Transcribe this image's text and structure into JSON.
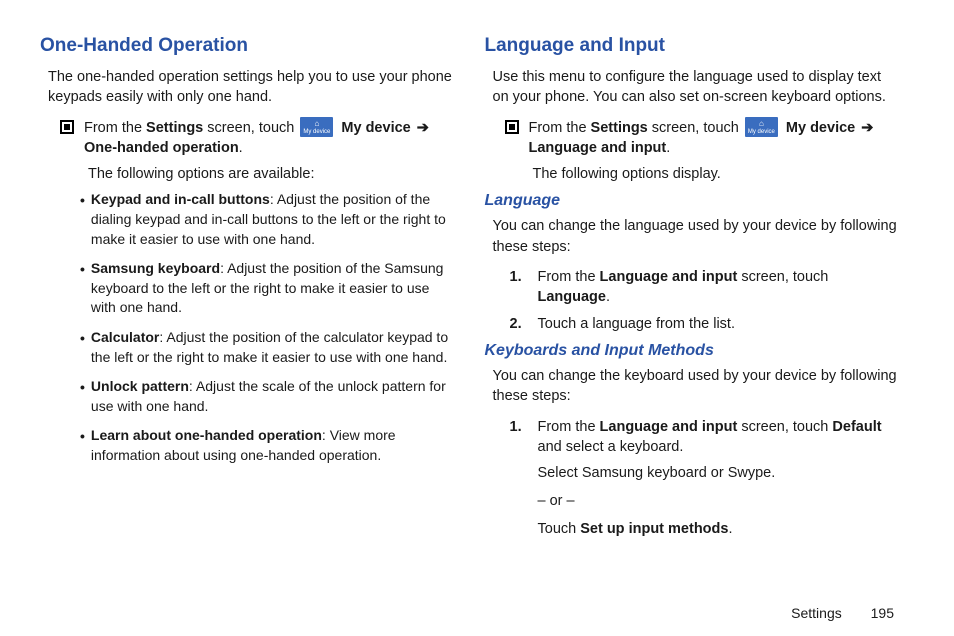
{
  "left": {
    "heading": "One-Handed Operation",
    "intro": "The one-handed operation settings help you to use your phone keypads easily with only one hand.",
    "step_prefix": "From the ",
    "settings_bold": "Settings",
    "step_mid": " screen, touch ",
    "icon_label": "My device",
    "my_device_bold": "My device",
    "arrow": "➔",
    "one_handed_bold": "One-handed operation",
    "period": ".",
    "following": "The following options are available:",
    "bullets": [
      {
        "bold": "Keypad and in-call buttons",
        "rest": ": Adjust the position of the dialing keypad and in-call buttons to the left or the right to make it easier to use with one hand."
      },
      {
        "bold": "Samsung keyboard",
        "rest": ": Adjust the position of the Samsung keyboard to the left or the right to make it easier to use with one hand."
      },
      {
        "bold": "Calculator",
        "rest": ": Adjust the position of the calculator keypad to the left or the right to make it easier to use with one hand."
      },
      {
        "bold": "Unlock pattern",
        "rest": ": Adjust the scale of the unlock pattern for use with one hand."
      },
      {
        "bold": "Learn about one-handed operation",
        "rest": ": View more information about using one-handed operation."
      }
    ]
  },
  "right": {
    "heading": "Language and Input",
    "intro": "Use this menu to configure the language used to display text on your phone. You can also set on-screen keyboard options.",
    "step_prefix": "From the ",
    "settings_bold": "Settings",
    "step_mid": " screen, touch ",
    "icon_label": "My device",
    "my_device_bold": "My device",
    "arrow": "➔",
    "lang_input_bold": "Language and input",
    "period": ".",
    "following": "The following options display.",
    "section_language": {
      "heading": "Language",
      "intro": "You can change the language used by your device by following these steps:",
      "steps": [
        {
          "num": "1.",
          "prefix": "From the ",
          "bold1": "Language and input",
          "mid": " screen, touch ",
          "bold2": "Language",
          "suffix": "."
        },
        {
          "num": "2.",
          "text": "Touch a language from the list."
        }
      ]
    },
    "section_keyboards": {
      "heading": "Keyboards and Input Methods",
      "intro": "You can change the keyboard used by your device by following these steps:",
      "step1": {
        "num": "1.",
        "prefix": "From the ",
        "bold1": "Language and input",
        "mid": " screen, touch ",
        "bold2": "Default",
        "suffix": " and select a keyboard."
      },
      "sub1": "Select Samsung keyboard or Swype.",
      "or": "– or –",
      "sub2_prefix": "Touch ",
      "sub2_bold": "Set up input methods",
      "sub2_suffix": "."
    }
  },
  "footer": {
    "section": "Settings",
    "page": "195"
  }
}
